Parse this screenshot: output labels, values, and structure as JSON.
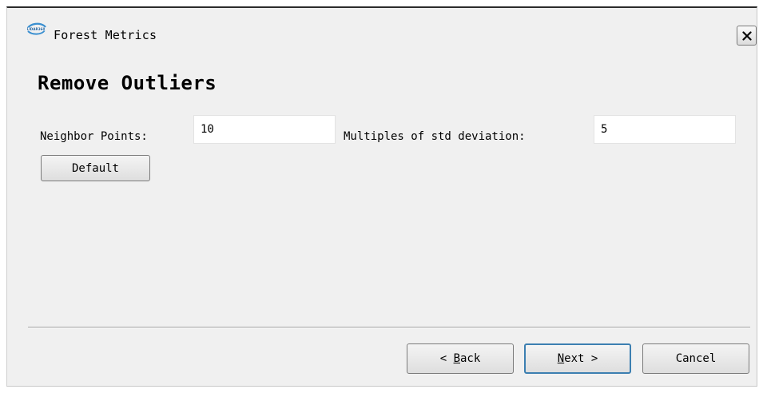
{
  "window": {
    "title": "Forest Metrics",
    "close_label": "×"
  },
  "page": {
    "title": "Remove Outliers"
  },
  "form": {
    "neighbor_points_label": "Neighbor Points:",
    "neighbor_points_value": "10",
    "multiples_label": "Multiples of std deviation:",
    "multiples_value": "5",
    "default_button": "Default"
  },
  "footer": {
    "back_label": "< Back",
    "back_mnemonic": "B",
    "next_label": "Next >",
    "next_mnemonic": "N",
    "cancel_label": "Cancel"
  },
  "colors": {
    "window_bg": "#f0f0f0",
    "focus_border": "#3c7fb1",
    "logo_blue": "#3a8fd0"
  },
  "icons": {
    "logo": "app-logo-icon",
    "close": "close-icon"
  }
}
